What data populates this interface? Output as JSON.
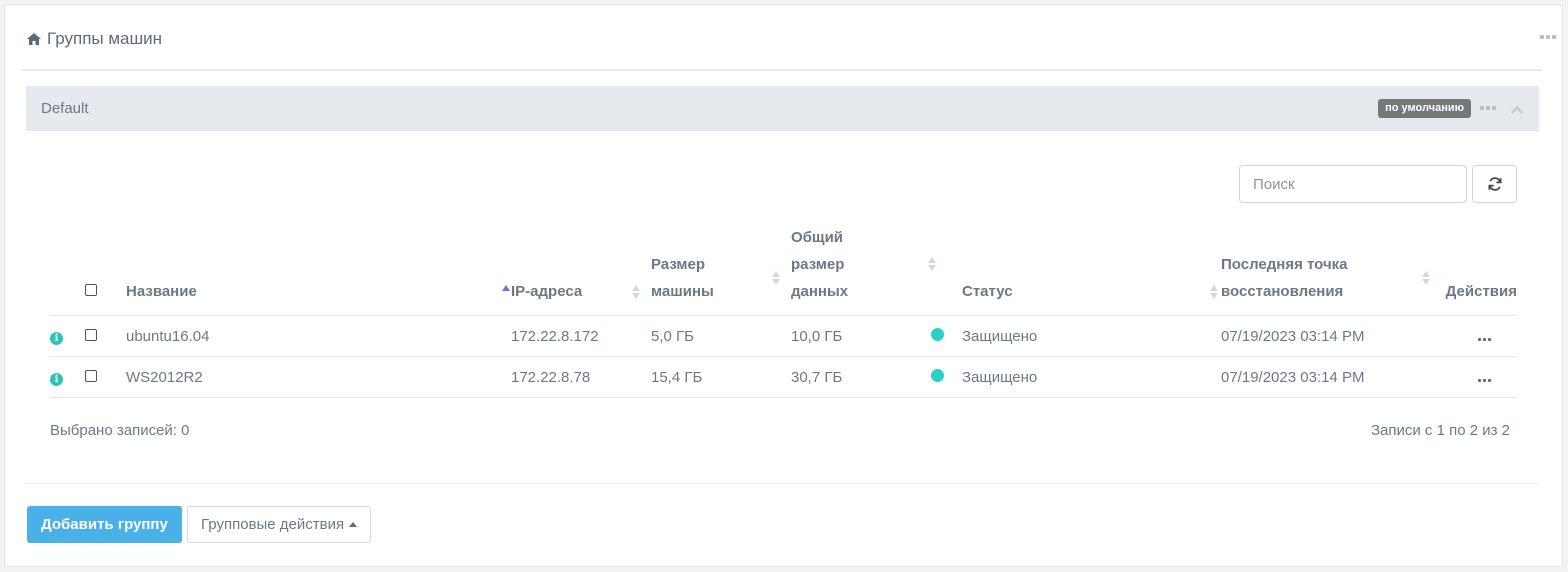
{
  "header": {
    "title": "Группы машин",
    "icon": "home-icon"
  },
  "group": {
    "name": "Default",
    "badge": "по умолчанию"
  },
  "search": {
    "placeholder": "Поиск",
    "value": ""
  },
  "table": {
    "columns": {
      "name": "Название",
      "ip": "IP-адреса",
      "size_1": "Размер",
      "size_2": "машины",
      "data_1": "Общий",
      "data_2": "размер",
      "data_3": "данных",
      "status": "Статус",
      "restore_1": "Последняя точка",
      "restore_2": "восстановления",
      "actions": "Действия"
    },
    "rows": [
      {
        "name": "ubuntu16.04",
        "ip": "172.22.8.172",
        "size": "5,0 ГБ",
        "data": "10,0 ГБ",
        "status": "Защищено",
        "restore": "07/19/2023 03:14 PM"
      },
      {
        "name": "WS2012R2",
        "ip": "172.22.8.78",
        "size": "15,4 ГБ",
        "data": "30,7 ГБ",
        "status": "Защищено",
        "restore": "07/19/2023 03:14 PM"
      }
    ]
  },
  "footer": {
    "selected": "Выбрано записей: 0",
    "records": "Записи с 1 по 2 из 2",
    "add_group": "Добавить группу",
    "group_actions": "Групповые действия"
  },
  "colors": {
    "accent": "#4ab1e8",
    "status_ok": "#2ed0c2",
    "sort_active": "#6c6ed9"
  }
}
